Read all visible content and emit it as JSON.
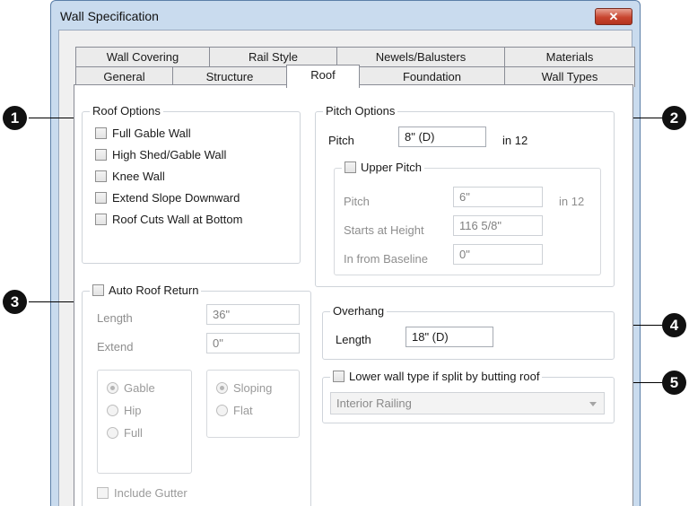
{
  "window": {
    "title": "Wall Specification",
    "close_glyph": "✕"
  },
  "tabs": {
    "row1": [
      "Wall Covering",
      "Rail Style",
      "Newels/Balusters",
      "Materials"
    ],
    "row2": [
      "General",
      "Structure",
      "Roof",
      "Foundation",
      "Wall Types"
    ],
    "active": "Roof"
  },
  "roof_options": {
    "legend": "Roof Options",
    "items": [
      "Full Gable Wall",
      "High Shed/Gable Wall",
      "Knee Wall",
      "Extend Slope Downward",
      "Roof Cuts Wall at Bottom"
    ]
  },
  "pitch_options": {
    "legend": "Pitch Options",
    "pitch_label": "Pitch",
    "pitch_value": "8\" (D)",
    "pitch_unit": "in 12",
    "upper": {
      "legend": "Upper Pitch",
      "pitch_label": "Pitch",
      "pitch_value": "6\"",
      "pitch_unit": "in 12",
      "starts_label": "Starts at Height",
      "starts_value": "116 5/8\"",
      "in_from_label": "In from Baseline",
      "in_from_value": "0\""
    }
  },
  "auto_roof_return": {
    "legend": "Auto Roof Return",
    "length_label": "Length",
    "length_value": "36\"",
    "extend_label": "Extend",
    "extend_value": "0\"",
    "type_options": [
      "Gable",
      "Hip",
      "Full"
    ],
    "type_selected": "Gable",
    "slope_options": [
      "Sloping",
      "Flat"
    ],
    "slope_selected": "Sloping",
    "gutter_label": "Include Gutter"
  },
  "overhang": {
    "legend": "Overhang",
    "length_label": "Length",
    "length_value": "18\" (D)"
  },
  "lower_wall": {
    "legend": "Lower wall type if split by butting roof",
    "selected": "Interior Railing"
  },
  "callouts": [
    "1",
    "2",
    "3",
    "4",
    "5"
  ]
}
